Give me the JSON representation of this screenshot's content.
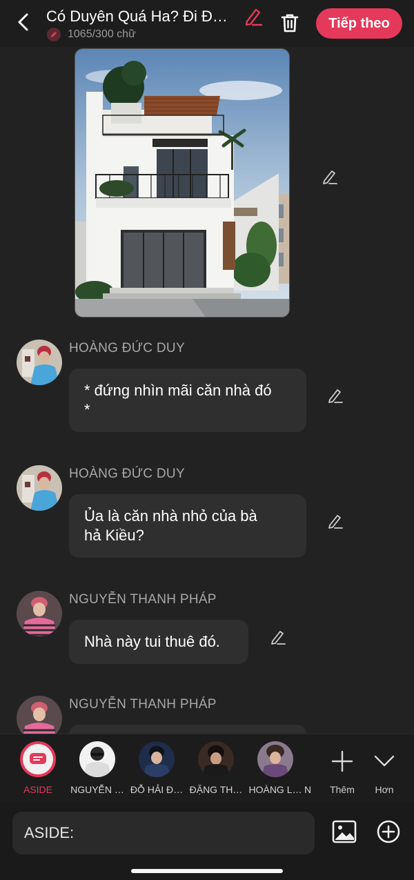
{
  "header": {
    "title": "Có Duyên Quá Ha? Đi Đ…",
    "word_count": "1065/300 chữ",
    "next_label": "Tiếp theo",
    "accent": "#e4395a"
  },
  "messages": [
    {
      "name": "HOÀNG ĐỨC DUY",
      "line1": "* đứng nhìn mãi căn nhà đó",
      "line2": "*"
    },
    {
      "name": "HOÀNG ĐỨC DUY",
      "line1": "Ủa là căn nhà nhỏ của bà",
      "line2": "hả Kiều?"
    },
    {
      "name": "NGUYỄN THANH PHÁP",
      "line1": "Nhà này tui thuê đó."
    },
    {
      "name": "NGUYỄN THANH PHÁP"
    }
  ],
  "characters": [
    {
      "label": "ASIDE",
      "selected": true
    },
    {
      "label": "NGUYỄN …"
    },
    {
      "label": "ĐỖ HẢI Đ…"
    },
    {
      "label": "ĐẶNG TH…"
    },
    {
      "label": "HOÀNG L…"
    },
    {
      "label": "N"
    }
  ],
  "actions": {
    "add_label": "Thêm",
    "more_label": "Hơn"
  },
  "input": {
    "value": "ASIDE:"
  }
}
